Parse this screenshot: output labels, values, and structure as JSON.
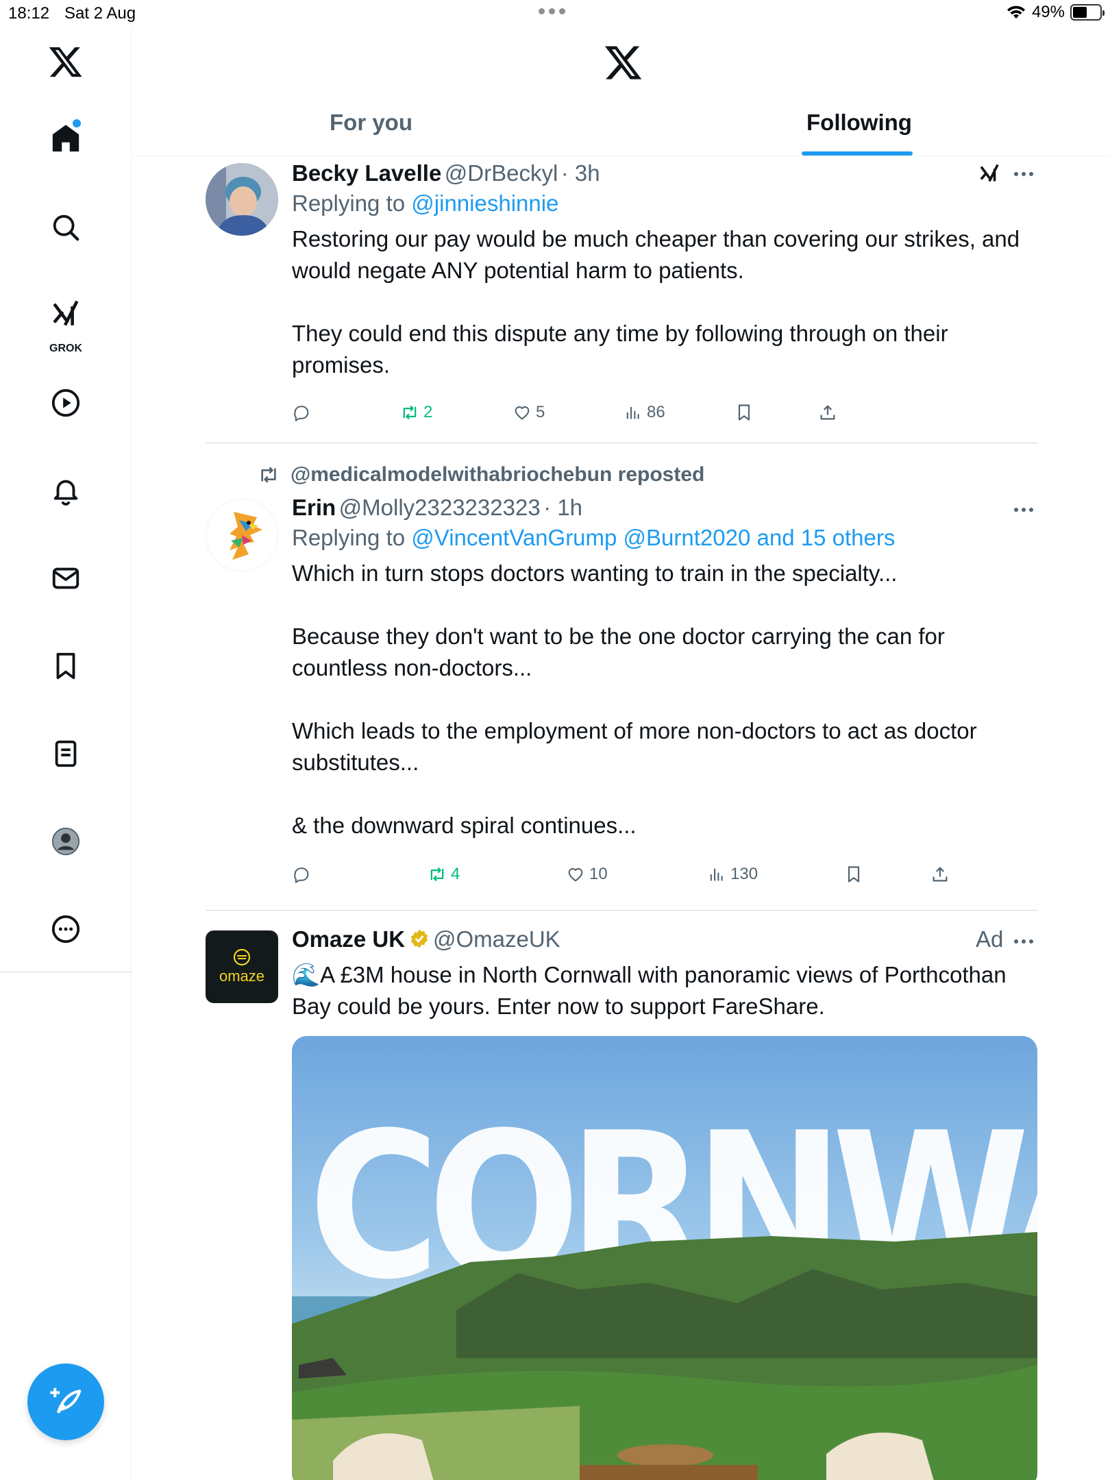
{
  "status_bar": {
    "time": "18:12",
    "date": "Sat 2 Aug",
    "battery": "49%",
    "battery_level": 0.49
  },
  "header": {
    "tabs": [
      {
        "label": "For you",
        "active": false
      },
      {
        "label": "Following",
        "active": true
      }
    ]
  },
  "sidebar": {
    "items": [
      {
        "name": "home",
        "icon": "home-icon",
        "has_notification_dot": true
      },
      {
        "name": "explore",
        "icon": "search-icon"
      },
      {
        "name": "grok",
        "icon": "grok-icon",
        "label": "GROK"
      },
      {
        "name": "video",
        "icon": "play-icon"
      },
      {
        "name": "notifications",
        "icon": "bell-icon"
      },
      {
        "name": "messages",
        "icon": "mail-icon"
      },
      {
        "name": "bookmarks",
        "icon": "bookmark-icon"
      },
      {
        "name": "lists",
        "icon": "list-icon"
      },
      {
        "name": "profile",
        "icon": "profile-icon"
      },
      {
        "name": "more",
        "icon": "more-icon"
      }
    ],
    "compose_icon": "compose-icon"
  },
  "posts": [
    {
      "name": "Becky Lavelle",
      "handle": "@DrBeckyl",
      "time": "· 3h",
      "reply_prefix": "Replying to",
      "reply_to": "@jinnieshinnie",
      "text": "Restoring our pay would be much cheaper than covering our strikes, and would negate ANY potential harm to patients.\n\nThey could end this dispute any time by following through on their promises.",
      "reposts": "2",
      "likes": "5",
      "views": "86"
    },
    {
      "reposted_by": "@medicalmodelwithabriochebun reposted",
      "name": "Erin",
      "handle": "@Molly2323232323",
      "time": "· 1h",
      "reply_prefix": "Replying to",
      "reply_to": "@VincentVanGrump @Burnt2020 and 15 others",
      "text": "Which in turn stops doctors wanting to train in the specialty...\n\nBecause they don't want to be the one doctor carrying the can for countless non-doctors...\n\nWhich leads to the employment of more non-doctors to act as doctor substitutes...\n\n& the downward spiral continues...",
      "reposts": "4",
      "likes": "10",
      "views": "130"
    },
    {
      "name": "Omaze UK",
      "handle": "@OmazeUK",
      "ad_label": "Ad",
      "avatar_text": "omaze",
      "text": "🌊A £3M house in North Cornwall with panoramic views of Porthcothan Bay could be yours. Enter now to support FareShare.",
      "image_text": "CORNWALL"
    }
  ],
  "colors": {
    "accent": "#1d9bf0",
    "repost_green": "#00ba7c",
    "secondary_text": "#536471"
  }
}
